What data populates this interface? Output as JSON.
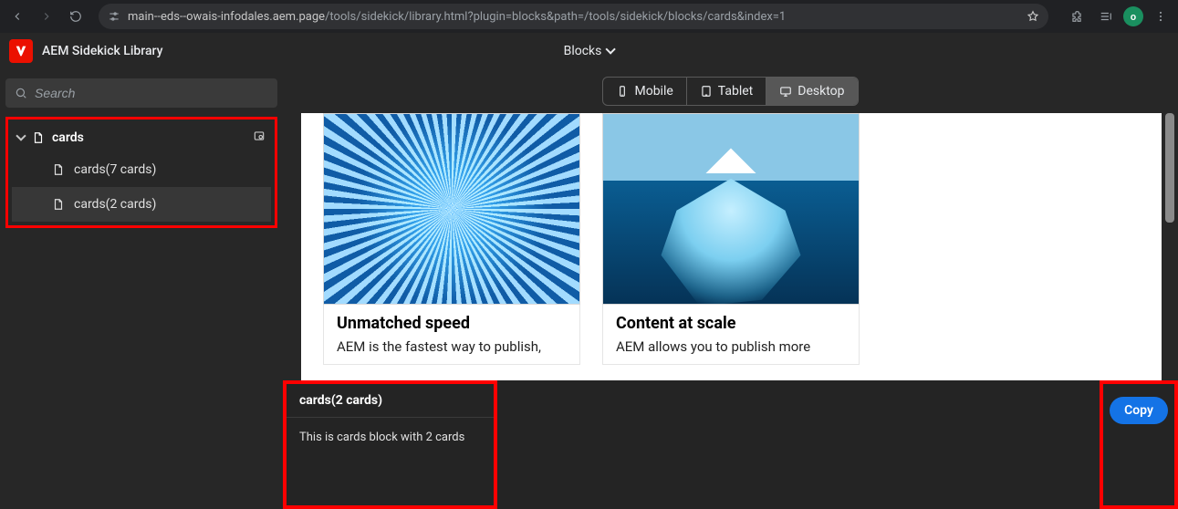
{
  "chrome": {
    "url_host": "main--eds--owais-infodales.aem.page",
    "url_path": "/tools/sidekick/library.html?plugin=blocks&path=/tools/sidekick/blocks/cards&index=1",
    "avatar_initial": "o"
  },
  "header": {
    "app_title": "AEM Sidekick Library",
    "dropdown_label": "Blocks"
  },
  "sidebar": {
    "search_placeholder": "Search",
    "group_label": "cards",
    "items": [
      {
        "label": "cards(7 cards)"
      },
      {
        "label": "cards(2 cards)"
      }
    ]
  },
  "device_tabs": {
    "mobile": "Mobile",
    "tablet": "Tablet",
    "desktop": "Desktop"
  },
  "preview": {
    "cards": [
      {
        "title": "Unmatched speed",
        "body": "AEM is the fastest way to publish,"
      },
      {
        "title": "Content at scale",
        "body": "AEM allows you to publish more"
      }
    ]
  },
  "footer": {
    "block_label": "cards(2 cards)",
    "block_desc": "This is cards block with 2 cards",
    "copy_label": "Copy"
  }
}
